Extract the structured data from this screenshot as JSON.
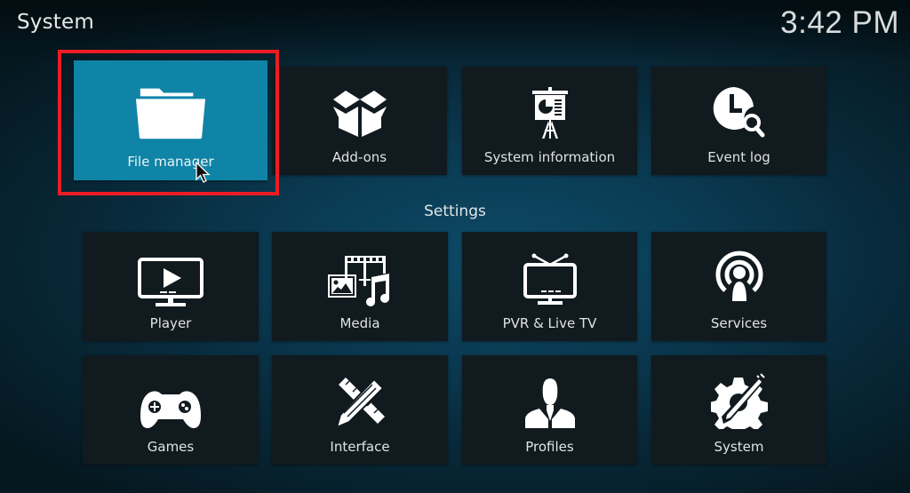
{
  "header": {
    "title": "System",
    "clock": "3:42 PM"
  },
  "top_row": [
    {
      "label": "File manager",
      "icon": "folder-icon",
      "focused": true
    },
    {
      "label": "Add-ons",
      "icon": "open-box-icon",
      "focused": false
    },
    {
      "label": "System information",
      "icon": "presentation-easel-icon",
      "focused": false
    },
    {
      "label": "Event log",
      "icon": "clock-search-icon",
      "focused": false
    }
  ],
  "settings": {
    "title": "Settings",
    "items": [
      {
        "label": "Player",
        "icon": "monitor-play-icon"
      },
      {
        "label": "Media",
        "icon": "media-film-photo-music-icon"
      },
      {
        "label": "PVR & Live TV",
        "icon": "tv-antenna-icon"
      },
      {
        "label": "Services",
        "icon": "broadcast-person-icon"
      },
      {
        "label": "Games",
        "icon": "gamepad-icon"
      },
      {
        "label": "Interface",
        "icon": "pencil-ruler-icon"
      },
      {
        "label": "Profiles",
        "icon": "person-icon"
      },
      {
        "label": "System",
        "icon": "gear-wrench-icon"
      }
    ]
  },
  "colors": {
    "focus": "#0f84a6",
    "tile": "#111a1f",
    "highlight": "#ec1c24"
  }
}
